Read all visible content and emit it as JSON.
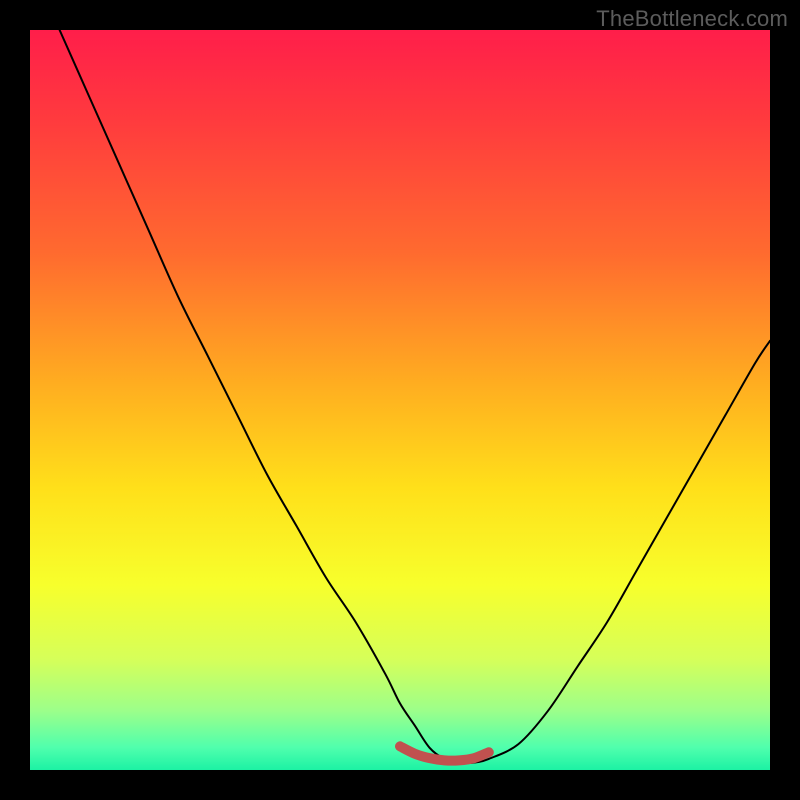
{
  "watermark": "TheBottleneck.com",
  "colors": {
    "frame": "#000000",
    "curve": "#000000",
    "highlight": "#c1514f",
    "gradient_stops": [
      {
        "offset": 0.0,
        "color": "#ff1e4a"
      },
      {
        "offset": 0.12,
        "color": "#ff3a3e"
      },
      {
        "offset": 0.3,
        "color": "#ff6a2f"
      },
      {
        "offset": 0.48,
        "color": "#ffae20"
      },
      {
        "offset": 0.62,
        "color": "#ffe01a"
      },
      {
        "offset": 0.75,
        "color": "#f7ff2c"
      },
      {
        "offset": 0.85,
        "color": "#d6ff59"
      },
      {
        "offset": 0.92,
        "color": "#9cff8a"
      },
      {
        "offset": 0.97,
        "color": "#4fffad"
      },
      {
        "offset": 1.0,
        "color": "#1cf2a4"
      }
    ]
  },
  "chart_data": {
    "type": "line",
    "title": "",
    "xlabel": "",
    "ylabel": "",
    "xlim": [
      0,
      100
    ],
    "ylim": [
      0,
      100
    ],
    "series": [
      {
        "name": "bottleneck-curve",
        "x": [
          4,
          8,
          12,
          16,
          20,
          24,
          28,
          32,
          36,
          40,
          44,
          48,
          50,
          52,
          54,
          56,
          58,
          60,
          62,
          66,
          70,
          74,
          78,
          82,
          86,
          90,
          94,
          98,
          100
        ],
        "y": [
          100,
          91,
          82,
          73,
          64,
          56,
          48,
          40,
          33,
          26,
          20,
          13,
          9,
          6,
          3,
          1.5,
          1,
          1,
          1.5,
          3.5,
          8,
          14,
          20,
          27,
          34,
          41,
          48,
          55,
          58
        ]
      }
    ],
    "highlight_segment": {
      "name": "near-minimum",
      "x": [
        50,
        52,
        54,
        56,
        58,
        60,
        62
      ],
      "y": [
        3.2,
        2.2,
        1.6,
        1.3,
        1.3,
        1.6,
        2.4
      ]
    }
  }
}
